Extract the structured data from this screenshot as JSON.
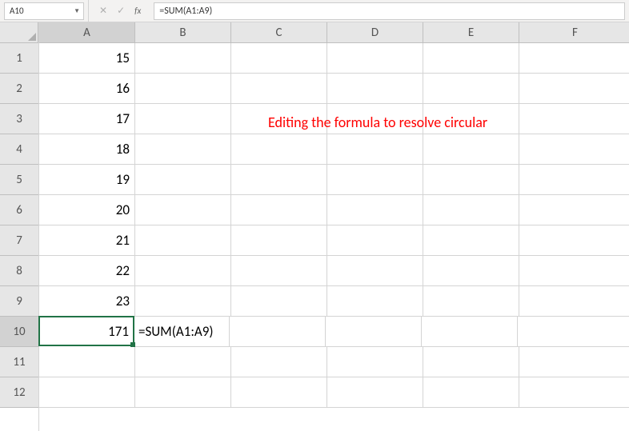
{
  "formula_bar": {
    "name_box": "A10",
    "formula": "=SUM(A1:A9)",
    "fx_label": "fx"
  },
  "columns": [
    "A",
    "B",
    "C",
    "D",
    "E",
    "F"
  ],
  "rows": [
    "1",
    "2",
    "3",
    "4",
    "5",
    "6",
    "7",
    "8",
    "9",
    "10",
    "11",
    "12"
  ],
  "cells": {
    "A1": "15",
    "A2": "16",
    "A3": "17",
    "A4": "18",
    "A5": "19",
    "A6": "20",
    "A7": "21",
    "A8": "22",
    "A9": "23",
    "A10": "171",
    "B10": "=SUM(A1:A9)"
  },
  "selected_cell": "A10",
  "annotation": "Editing the formula to resolve circular",
  "chart_data": {
    "type": "table",
    "title": "",
    "columns": [
      "A"
    ],
    "rows": [
      {
        "row": 1,
        "A": 15
      },
      {
        "row": 2,
        "A": 16
      },
      {
        "row": 3,
        "A": 17
      },
      {
        "row": 4,
        "A": 18
      },
      {
        "row": 5,
        "A": 19
      },
      {
        "row": 6,
        "A": 20
      },
      {
        "row": 7,
        "A": 21
      },
      {
        "row": 8,
        "A": 22
      },
      {
        "row": 9,
        "A": 23
      },
      {
        "row": 10,
        "A": 171
      }
    ],
    "formula_in_B10": "=SUM(A1:A9)"
  }
}
